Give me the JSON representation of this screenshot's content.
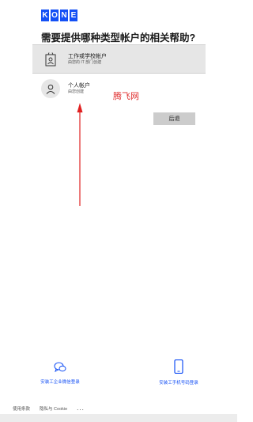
{
  "brand": {
    "letters": [
      "K",
      "O",
      "N",
      "E"
    ],
    "color": "#1450f5"
  },
  "heading": "需要提供哪种类型帐户的相关帮助?",
  "options": [
    {
      "title": "工作或学校帐户",
      "subtitle": "由您的 IT 部门创建",
      "icon": "id-badge-icon",
      "selected": true
    },
    {
      "title": "个人帐户",
      "subtitle": "由您创建",
      "icon": "person-icon",
      "selected": false
    }
  ],
  "watermark": "腾飞网",
  "back_label": "后退",
  "footer": {
    "wechat_label": "安装工企业微信登录",
    "phone_label": "安装工手机号码登录",
    "wechat_icon": "wechat-icon",
    "phone_icon": "phone-icon"
  },
  "bottom": {
    "terms": "使用条款",
    "privacy": "隐私与 Cookie",
    "more": "..."
  },
  "colors": {
    "accent": "#1450f5",
    "arrow": "#e02020",
    "selected_bg": "#e6e6e6"
  }
}
